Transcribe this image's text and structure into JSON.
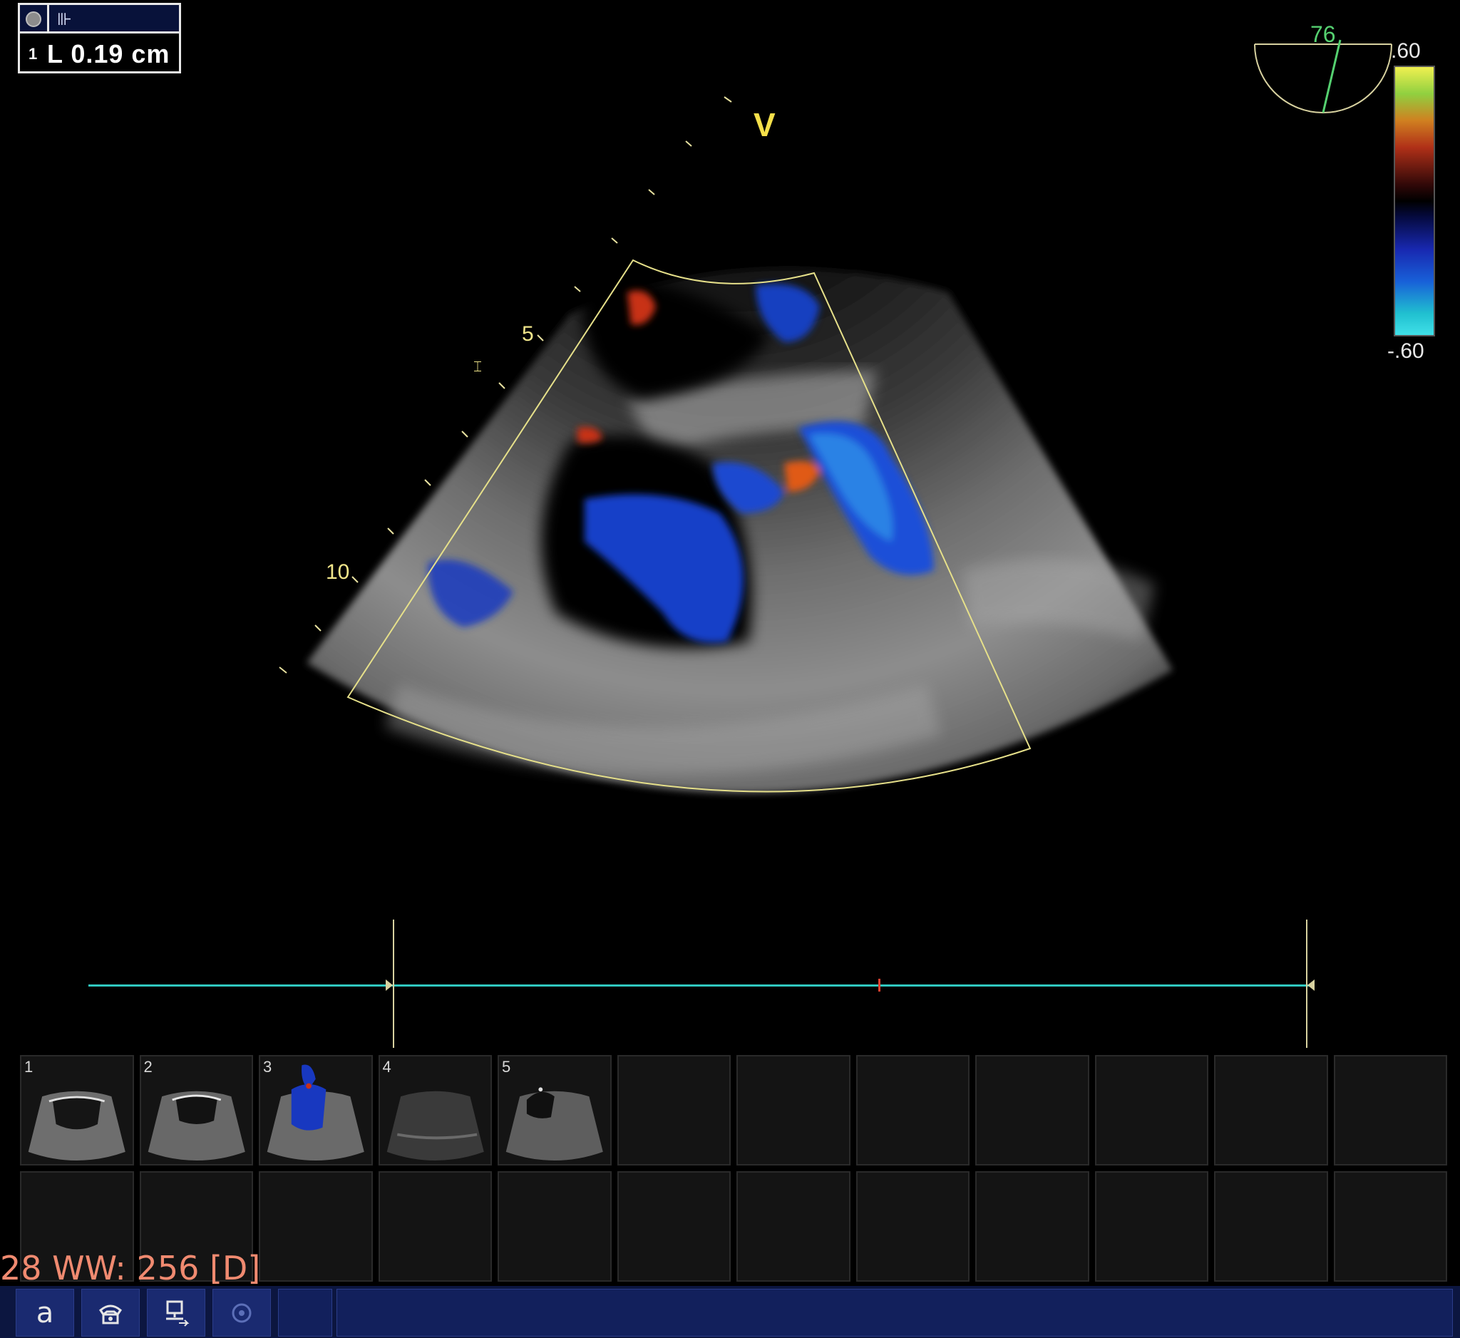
{
  "measurement": {
    "index": "1",
    "value": "L  0.19 cm"
  },
  "image": {
    "view_marker": "V",
    "depth_labels": [
      "5",
      "10"
    ]
  },
  "color_scale": {
    "angle": "76",
    "top": ".60",
    "bottom": "-.60",
    "colors": {
      "positive": "#f0f050",
      "negative": "#40e0e8",
      "mid": "#000000"
    }
  },
  "cine": {
    "line_color": "#30c8c0",
    "marker_color": "#e04030"
  },
  "thumbnails": [
    {
      "num": "1",
      "icon": "ultrasound-thumbnail"
    },
    {
      "num": "2",
      "icon": "ultrasound-thumbnail"
    },
    {
      "num": "3",
      "icon": "color-doppler-thumbnail"
    },
    {
      "num": "4",
      "icon": "ultrasound-thumbnail"
    },
    {
      "num": "5",
      "icon": "ultrasound-thumbnail"
    }
  ],
  "status": {
    "window_level": "28 WW: 256 [D]"
  },
  "toolbar": {
    "buttons": [
      {
        "label": "a",
        "icon": "text-annotation-icon"
      },
      {
        "label": "",
        "icon": "phone-icon"
      },
      {
        "label": "",
        "icon": "network-computer-icon"
      },
      {
        "label": "",
        "icon": "target-icon"
      }
    ]
  }
}
